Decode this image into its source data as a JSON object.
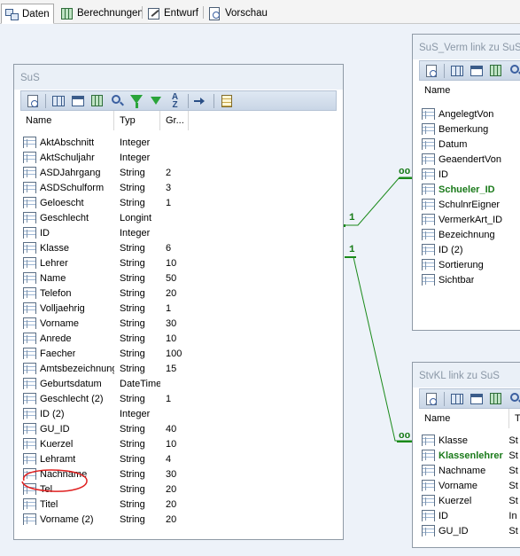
{
  "tabs": [
    {
      "label": "Daten",
      "icon": "data-view-icon",
      "active": true
    },
    {
      "label": "Berechnungen",
      "icon": "calculation-icon",
      "active": false
    },
    {
      "label": "Entwurf",
      "icon": "design-icon",
      "active": false
    },
    {
      "label": "Vorschau",
      "icon": "preview-icon",
      "active": false
    }
  ],
  "colors": {
    "canvas": "#edf2f9",
    "relation": "#1a8a1a",
    "key_field": "#1a7a1a",
    "annotation": "#e02020"
  },
  "sus": {
    "title": "SuS",
    "columns": [
      "Name",
      "Typ",
      "Gr..."
    ],
    "fields": [
      {
        "name": "AktAbschnitt",
        "type": "Integer",
        "size": ""
      },
      {
        "name": "AktSchuljahr",
        "type": "Integer",
        "size": ""
      },
      {
        "name": "ASDJahrgang",
        "type": "String",
        "size": "2"
      },
      {
        "name": "ASDSchulform",
        "type": "String",
        "size": "3"
      },
      {
        "name": "Geloescht",
        "type": "String",
        "size": "1"
      },
      {
        "name": "Geschlecht",
        "type": "Longint",
        "size": ""
      },
      {
        "name": "ID",
        "type": "Integer",
        "size": ""
      },
      {
        "name": "Klasse",
        "type": "String",
        "size": "6"
      },
      {
        "name": "Lehrer",
        "type": "String",
        "size": "10"
      },
      {
        "name": "Name",
        "type": "String",
        "size": "50"
      },
      {
        "name": "Telefon",
        "type": "String",
        "size": "20"
      },
      {
        "name": "Volljaehrig",
        "type": "String",
        "size": "1"
      },
      {
        "name": "Vorname",
        "type": "String",
        "size": "30"
      },
      {
        "name": "Anrede",
        "type": "String",
        "size": "10"
      },
      {
        "name": "Faecher",
        "type": "String",
        "size": "100"
      },
      {
        "name": "Amtsbezeichnung",
        "type": "String",
        "size": "15"
      },
      {
        "name": "Geburtsdatum",
        "type": "DateTime",
        "size": ""
      },
      {
        "name": "Geschlecht (2)",
        "type": "String",
        "size": "1"
      },
      {
        "name": "ID (2)",
        "type": "Integer",
        "size": ""
      },
      {
        "name": "GU_ID",
        "type": "String",
        "size": "40"
      },
      {
        "name": "Kuerzel",
        "type": "String",
        "size": "10"
      },
      {
        "name": "Lehramt",
        "type": "String",
        "size": "4"
      },
      {
        "name": "Nachname",
        "type": "String",
        "size": "30"
      },
      {
        "name": "Tel",
        "type": "String",
        "size": "20"
      },
      {
        "name": "Titel",
        "type": "String",
        "size": "20"
      },
      {
        "name": "Vorname (2)",
        "type": "String",
        "size": "20"
      }
    ],
    "highlighted_field": "Lehramt"
  },
  "verm": {
    "title": "SuS_Verm link zu SuS",
    "columns": [
      "Name"
    ],
    "fields": [
      {
        "name": "AngelegtVon",
        "key": false
      },
      {
        "name": "Bemerkung",
        "key": false
      },
      {
        "name": "Datum",
        "key": false
      },
      {
        "name": "GeaendertVon",
        "key": false
      },
      {
        "name": "ID",
        "key": false
      },
      {
        "name": "Schueler_ID",
        "key": true
      },
      {
        "name": "SchulnrEigner",
        "key": false
      },
      {
        "name": "VermerkArt_ID",
        "key": false
      },
      {
        "name": "Bezeichnung",
        "key": false
      },
      {
        "name": "ID (2)",
        "key": false
      },
      {
        "name": "Sortierung",
        "key": false
      },
      {
        "name": "Sichtbar",
        "key": false
      }
    ]
  },
  "stvkl": {
    "title": "StvKL link zu SuS",
    "columns": [
      "Name",
      "T"
    ],
    "fields": [
      {
        "name": "Klasse",
        "type": "St",
        "key": false
      },
      {
        "name": "Klassenlehrer",
        "type": "St",
        "key": true
      },
      {
        "name": "Nachname",
        "type": "St",
        "key": false
      },
      {
        "name": "Vorname",
        "type": "St",
        "key": false
      },
      {
        "name": "Kuerzel",
        "type": "St",
        "key": false
      },
      {
        "name": "ID",
        "type": "In",
        "key": false
      },
      {
        "name": "GU_ID",
        "type": "St",
        "key": false
      }
    ]
  },
  "relations": [
    {
      "from_label": "1",
      "to_label": "oo"
    },
    {
      "from_label": "1",
      "to_label": "oo"
    }
  ]
}
